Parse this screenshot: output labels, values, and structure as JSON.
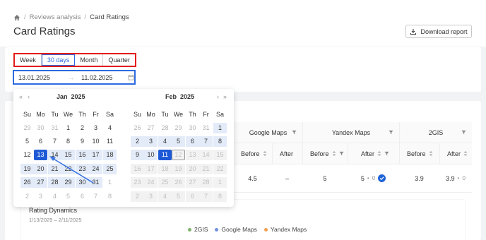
{
  "breadcrumb": {
    "parent": "Reviews analysis",
    "current": "Card Ratings"
  },
  "page_title": "Card Ratings",
  "download_button": "Download report",
  "periods": [
    "Week",
    "30 days",
    "Month",
    "Quarter"
  ],
  "active_period": "30 days",
  "range": {
    "start": "13.01.2025",
    "end": "11.02.2025"
  },
  "calendar": {
    "weekdays": [
      "Su",
      "Mo",
      "Tu",
      "We",
      "Th",
      "Fr",
      "Sa"
    ],
    "left": {
      "month": "Jan",
      "year": "2025",
      "days": [
        [
          "29",
          "30",
          "31",
          "1",
          "2",
          "3",
          "4"
        ],
        [
          "5",
          "6",
          "7",
          "8",
          "9",
          "10",
          "11"
        ],
        [
          "12",
          "13",
          "14",
          "15",
          "16",
          "17",
          "18"
        ],
        [
          "19",
          "20",
          "21",
          "22",
          "23",
          "24",
          "25"
        ],
        [
          "26",
          "27",
          "28",
          "29",
          "30",
          "31",
          "1"
        ],
        [
          "2",
          "3",
          "4",
          "5",
          "6",
          "7",
          "8"
        ]
      ]
    },
    "right": {
      "month": "Feb",
      "year": "2025",
      "days": [
        [
          "26",
          "27",
          "28",
          "29",
          "30",
          "31",
          "1"
        ],
        [
          "2",
          "3",
          "4",
          "5",
          "6",
          "7",
          "8"
        ],
        [
          "9",
          "10",
          "11",
          "12",
          "13",
          "14",
          "15"
        ],
        [
          "16",
          "17",
          "18",
          "19",
          "20",
          "21",
          "22"
        ],
        [
          "23",
          "24",
          "25",
          "26",
          "27",
          "28",
          "1"
        ],
        [
          "2",
          "3",
          "4",
          "5",
          "6",
          "7",
          "8"
        ]
      ]
    }
  },
  "table": {
    "groups": [
      "Google Maps",
      "Yandex Maps",
      "2GIS"
    ],
    "before_label": "Before",
    "after_label": "After",
    "row": {
      "google_before": "4.5",
      "google_after": "–",
      "yandex_before": "5",
      "yandex_after": "5",
      "yandex_after_dot": "•",
      "yandex_after_delta": "0",
      "gis_before": "3.9",
      "gis_after": "3.9",
      "gis_after_dot": "•",
      "gis_after_delta": "0"
    }
  },
  "dynamics": {
    "title": "Rating Dynamics",
    "range": "1/13/2025 – 2/11/2025",
    "legend": [
      {
        "label": "2GIS",
        "color": "#7fb36b"
      },
      {
        "label": "Google Maps",
        "color": "#6f8fe0"
      },
      {
        "label": "Yandex Maps",
        "color": "#f0a050"
      }
    ]
  },
  "colors": {
    "accent": "#1f5ad6",
    "highlight_red": "#e21b1b",
    "highlight_blue": "#2d6be0"
  }
}
